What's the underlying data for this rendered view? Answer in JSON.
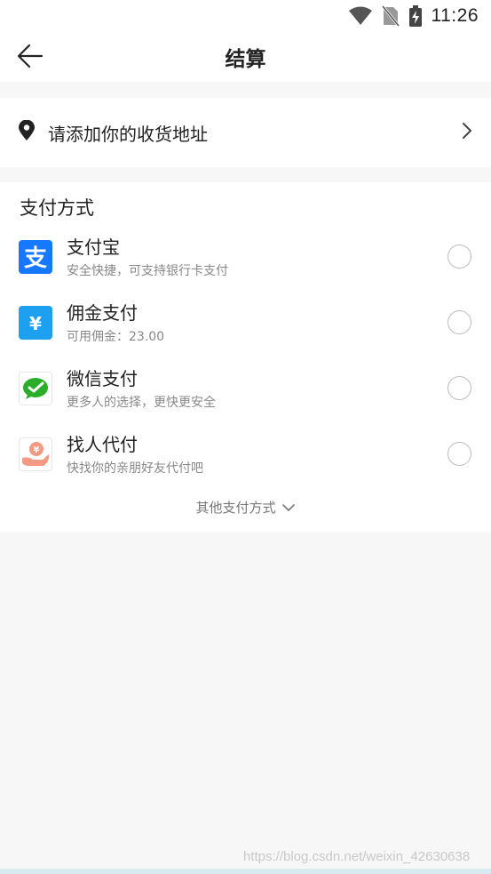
{
  "status_bar": {
    "time": "11:26",
    "icons": [
      "wifi-icon",
      "no-sim-icon",
      "battery-icon"
    ]
  },
  "nav": {
    "title": "结算",
    "back_icon": "arrow-left-icon"
  },
  "address": {
    "prompt": "请添加你的收货地址",
    "icon": "location-pin-icon",
    "chevron": "chevron-right-icon"
  },
  "payment": {
    "heading": "支付方式",
    "methods": [
      {
        "name": "支付宝",
        "desc": "安全快捷，可支持银行卡支付",
        "icon": "alipay-icon",
        "color": "#1677ff"
      },
      {
        "name": "佣金支付",
        "desc": "可用佣金：23.00",
        "icon": "yen-icon",
        "color": "#1ea0f0"
      },
      {
        "name": "微信支付",
        "desc": "更多人的选择，更快更安全",
        "icon": "wechat-pay-icon",
        "color": "#2aae2a"
      },
      {
        "name": "找人代付",
        "desc": "快找你的亲朋好友代付吧",
        "icon": "hand-coin-icon",
        "color": "#f59a82"
      }
    ],
    "more": "其他支付方式"
  },
  "watermark": "https://blog.csdn.net/weixin_42630638"
}
